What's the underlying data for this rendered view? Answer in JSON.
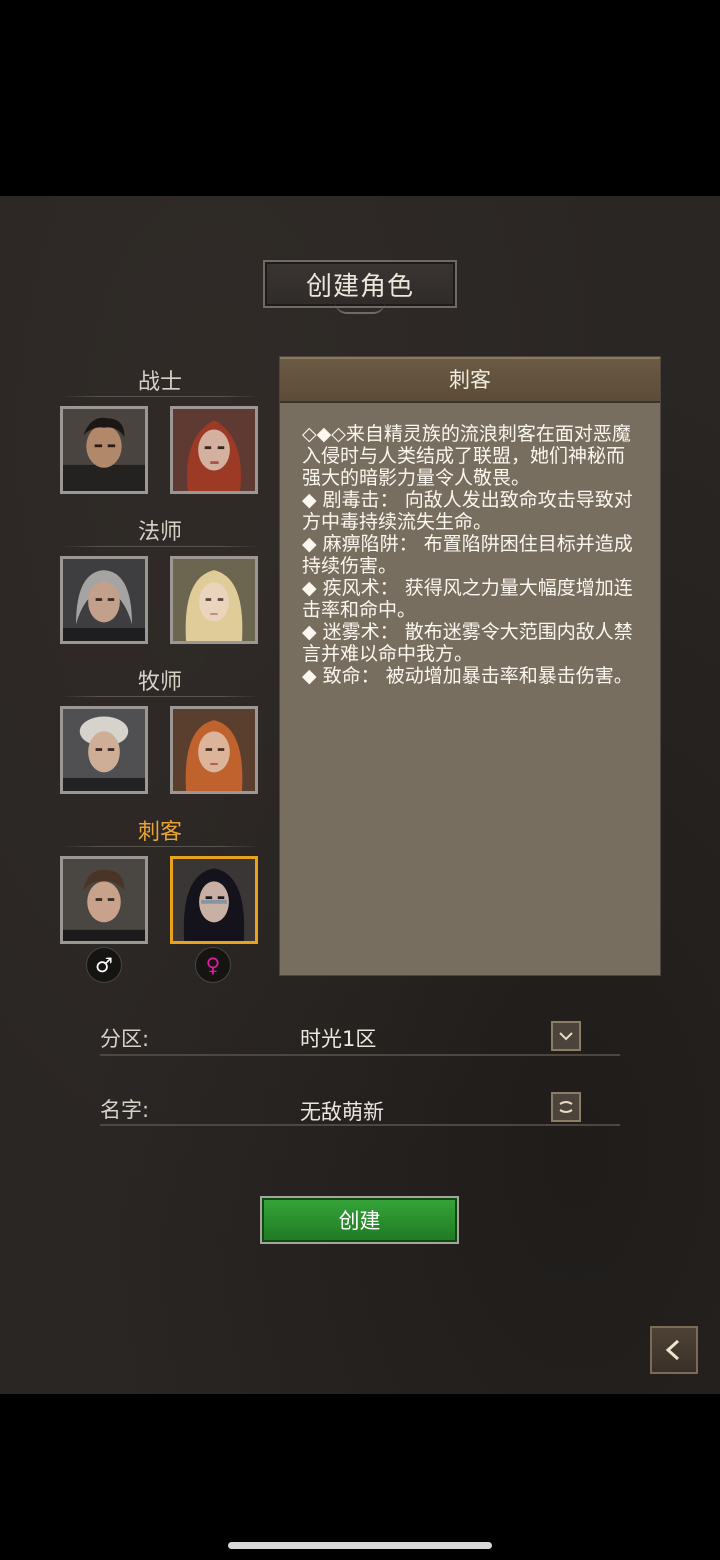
{
  "title": "创建角色",
  "classes": [
    {
      "name": "战士",
      "active": false
    },
    {
      "name": "法师",
      "active": false
    },
    {
      "name": "牧师",
      "active": false
    },
    {
      "name": "刺客",
      "active": true
    }
  ],
  "gender_icons": {
    "male": "♂",
    "female": "♀"
  },
  "description": {
    "header": "刺客",
    "lines": [
      "◇◆◇来自精灵族的流浪刺客在面对恶魔入侵时与人类结成了联盟，她们神秘而强大的暗影力量令人敬畏。",
      "◆ 剧毒击： 向敌人发出致命攻击导致对方中毒持续流失生命。",
      "◆ 麻痹陷阱： 布置陷阱困住目标并造成持续伤害。",
      "◆ 疾风术： 获得风之力量大幅度增加连击率和命中。",
      "◆ 迷雾术： 散布迷雾令大范围内敌人禁言并难以命中我方。",
      "◆ 致命： 被动增加暴击率和暴击伤害。"
    ]
  },
  "server": {
    "label": "分区:",
    "value": "时光1区",
    "icon": "dropdown-icon"
  },
  "name": {
    "label": "名字:",
    "value": "无敌萌新",
    "icon": "random-name-icon"
  },
  "create_button": "创建",
  "back_button_icon": "back-arrow-icon",
  "colors": {
    "active_class": "#e8a23a",
    "female_symbol": "#e21aa4",
    "create_green": "#2a9a2e"
  }
}
